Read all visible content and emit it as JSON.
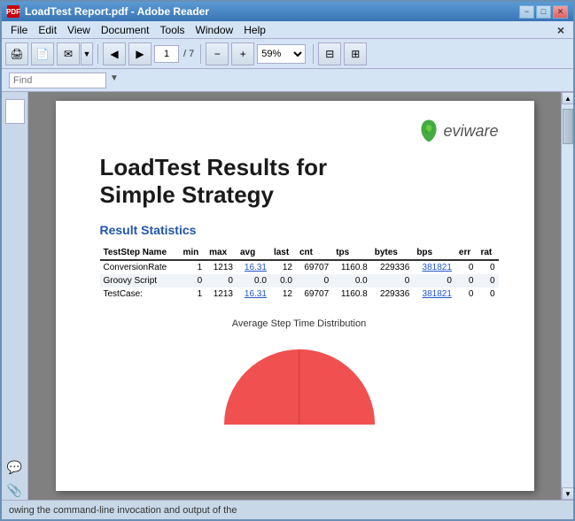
{
  "window": {
    "title": "LoadTest Report.pdf - Adobe Reader",
    "icon": "PDF"
  },
  "title_bar": {
    "title": "LoadTest Report.pdf - Adobe Reader",
    "minimize_label": "−",
    "maximize_label": "□",
    "close_label": "✕"
  },
  "menu": {
    "items": [
      "File",
      "Edit",
      "View",
      "Document",
      "Tools",
      "Window",
      "Help"
    ]
  },
  "toolbar": {
    "print_icon": "🖨",
    "nav_prev": "◄",
    "nav_next": "►",
    "page_current": "1",
    "page_total": "/ 7",
    "zoom_minus": "−",
    "zoom_plus": "+",
    "zoom_value": "59%",
    "fit_page": "⊡",
    "fit_width": "⊠"
  },
  "find_bar": {
    "placeholder": "Find",
    "dropdown_icon": "▼"
  },
  "pdf": {
    "logo_text": "eviware",
    "title_line1": "LoadTest Results for",
    "title_line2": "Simple Strategy",
    "section_title": "Result Statistics",
    "table": {
      "headers": [
        "TestStep Name",
        "min",
        "max",
        "avg",
        "last",
        "cnt",
        "tps",
        "bytes",
        "bps",
        "err",
        "rat"
      ],
      "rows": [
        {
          "name": "ConversionRate",
          "min": "1",
          "max": "1213",
          "avg": "16.31",
          "last": "12",
          "cnt": "69707",
          "tps": "1160.8",
          "bytes": "229336",
          "bps": "381821",
          "err": "0",
          "rat": "0",
          "avg_linked": true,
          "bps_linked": true
        },
        {
          "name": "Groovy Script",
          "min": "0",
          "max": "0",
          "avg": "0.0",
          "last": "0.0",
          "cnt": "0",
          "tps": "0.0",
          "bytes": "0",
          "bps": "0",
          "err": "0",
          "rat": "0",
          "avg_linked": false,
          "bps_linked": false
        },
        {
          "name": "TestCase:",
          "min": "1",
          "max": "1213",
          "avg": "16.31",
          "last": "12",
          "cnt": "69707",
          "tps": "1160.8",
          "bytes": "229336",
          "bps": "381821",
          "err": "0",
          "rat": "0",
          "avg_linked": true,
          "bps_linked": true
        }
      ]
    },
    "chart_title": "Average Step Time Distribution"
  },
  "sidebar_icons": {
    "note_icon": "💬",
    "clip_icon": "📎"
  },
  "bottom_text": "owing the command-line invocation and output of the",
  "scrollbar": {
    "up": "▲",
    "down": "▼"
  },
  "close_x": "×"
}
